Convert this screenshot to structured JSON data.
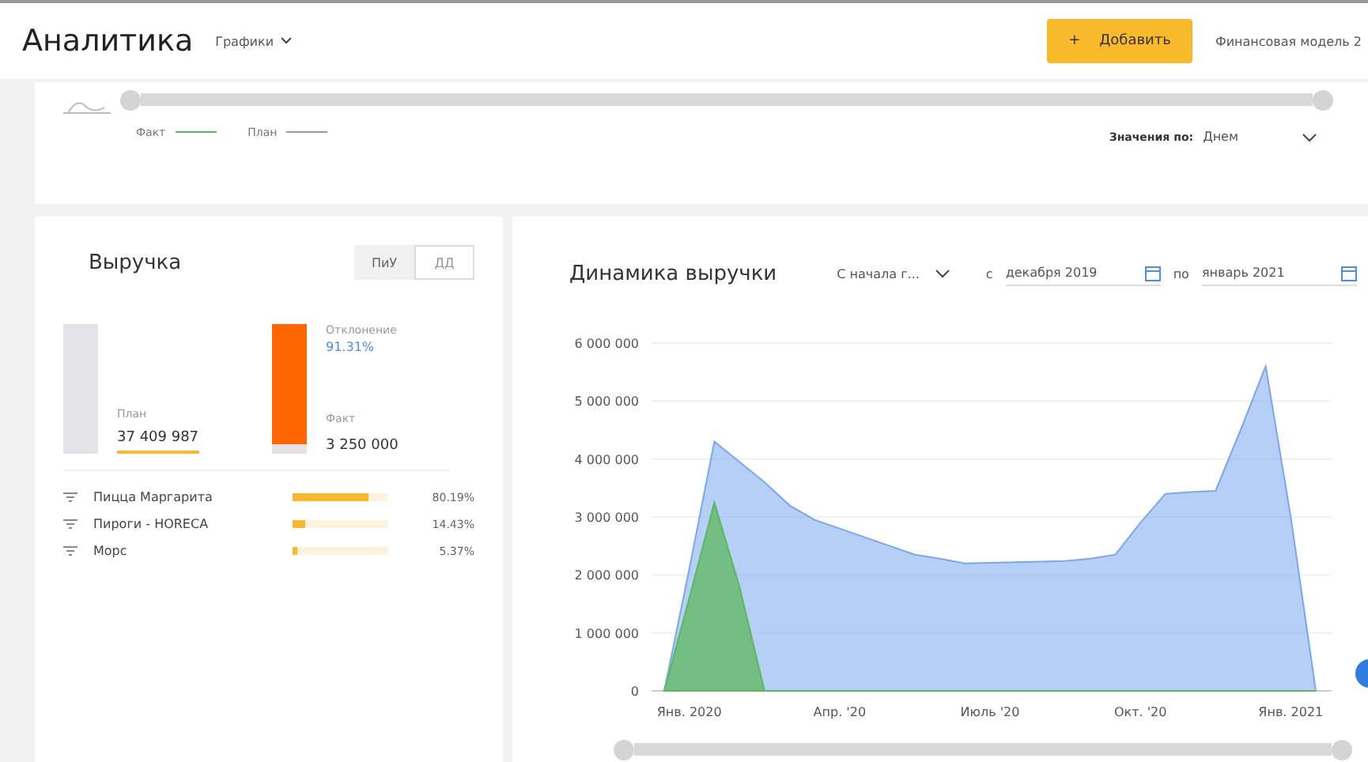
{
  "header": {
    "title": "Аналитика",
    "view_menu": "Графики",
    "add_button": {
      "icon": "+",
      "label": "Добавить"
    },
    "model": "Финансовая модель 2"
  },
  "overview": {
    "range_slider": {
      "level": 1
    },
    "legend": [
      {
        "label": "Факт",
        "color": "#5cb85c"
      },
      {
        "label": "План",
        "color": "#999999"
      }
    ],
    "values_by": {
      "label": "Значения по:",
      "value": "Днем"
    }
  },
  "revenue": {
    "title": "Выручка",
    "toggle": [
      {
        "label": "ПиУ",
        "selected": false
      },
      {
        "label": "ДД",
        "selected": true
      }
    ],
    "plan": {
      "label": "План",
      "value": "37 409 987"
    },
    "fact": {
      "label": "Факт",
      "value": "3 250 000",
      "level": 0.93
    },
    "deviation": {
      "label": "Отклонение",
      "value": "91.31%"
    },
    "items": [
      {
        "name": "Пицца Маргарита",
        "level": 0.8,
        "percent": "80.19%"
      },
      {
        "name": "Пироги - HORECA",
        "level": 0.14,
        "percent": "14.43%"
      },
      {
        "name": "Морс",
        "level": 0.05,
        "percent": "5.37%"
      }
    ]
  },
  "dynamics": {
    "title": "Динамика выручки",
    "period": "С начала г...",
    "from_label": "с",
    "from": "декабря 2019",
    "to_label": "по",
    "to": "январь 2021",
    "range_slider": {
      "level": 1
    },
    "chart_data": {
      "type": "area",
      "categories": [
        null,
        "Янв. 2020",
        null,
        null,
        null,
        null,
        null,
        "Апр. '20",
        null,
        null,
        null,
        null,
        null,
        "Июль '20",
        null,
        null,
        null,
        null,
        null,
        "Окт. '20",
        null,
        null,
        null,
        null,
        null,
        "Янв. 2021",
        null
      ],
      "series": [
        {
          "color": "#7aa7ef",
          "values": [
            0,
            2100000,
            4300000,
            3950000,
            3600000,
            3200000,
            2950000,
            2800000,
            2650000,
            2500000,
            2350000,
            2280000,
            2200000,
            2210000,
            2220000,
            2230000,
            2240000,
            2280000,
            2350000,
            2900000,
            3400000,
            3430000,
            3450000,
            4500000,
            5600000,
            3000000,
            0
          ]
        },
        {
          "color": "#5cb85c",
          "values": [
            0,
            1600000,
            3250000,
            1800000,
            0,
            0,
            0,
            0,
            0,
            0,
            0,
            0,
            0,
            0,
            0,
            0,
            0,
            0,
            0,
            0,
            0,
            0,
            0,
            0,
            0,
            0,
            0
          ]
        }
      ],
      "ylim": [
        0,
        6000000
      ],
      "grid": true,
      "yticks": [
        {
          "value": 0,
          "label": "0"
        },
        {
          "value": 1000000,
          "label": "1 000 000"
        },
        {
          "value": 2000000,
          "label": "2 000 000"
        },
        {
          "value": 3000000,
          "label": "3 000 000"
        },
        {
          "value": 4000000,
          "label": "4 000 000"
        },
        {
          "value": 5000000,
          "label": "5 000 000"
        },
        {
          "value": 6000000,
          "label": "6 000 000"
        }
      ]
    }
  }
}
